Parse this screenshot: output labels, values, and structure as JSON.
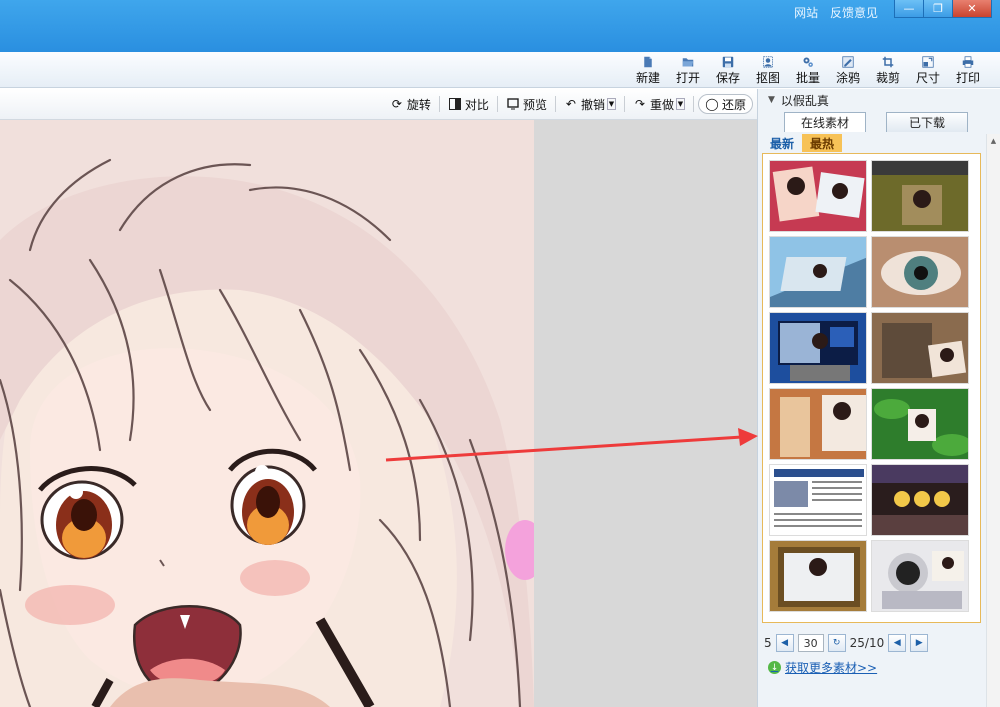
{
  "titlebar": {
    "links": [
      "网站",
      "反馈意见"
    ],
    "window_buttons": [
      "—",
      "❐",
      "✕"
    ]
  },
  "toolbar": {
    "items": [
      {
        "label": "新建",
        "icon": "new-file-icon"
      },
      {
        "label": "打开",
        "icon": "folder-open-icon"
      },
      {
        "label": "保存",
        "icon": "floppy-save-icon"
      },
      {
        "label": "抠图",
        "icon": "cutout-icon"
      },
      {
        "label": "批量",
        "icon": "batch-gear-icon"
      },
      {
        "label": "涂鸦",
        "icon": "graffiti-icon"
      },
      {
        "label": "裁剪",
        "icon": "crop-icon"
      },
      {
        "label": "尺寸",
        "icon": "resize-icon"
      },
      {
        "label": "打印",
        "icon": "printer-icon"
      }
    ]
  },
  "subbar": {
    "rotate": "旋转",
    "compare": "对比",
    "preview": "预览",
    "undo": "撤销",
    "redo": "重做",
    "restore": "还原"
  },
  "panel": {
    "title": "以假乱真",
    "tabs": [
      "在线素材",
      "已下载"
    ],
    "subtabs": [
      "最新",
      "最热"
    ],
    "pager": {
      "left_label": "5",
      "page_input": "30",
      "page_info": "25/10",
      "prev": "◀",
      "next": "▶"
    },
    "more_link": "获取更多素材>>"
  },
  "colors": {
    "title_bar": "#2a8fe0",
    "accent_hot": "#f7c257",
    "arrow": "#ee3b3b"
  }
}
